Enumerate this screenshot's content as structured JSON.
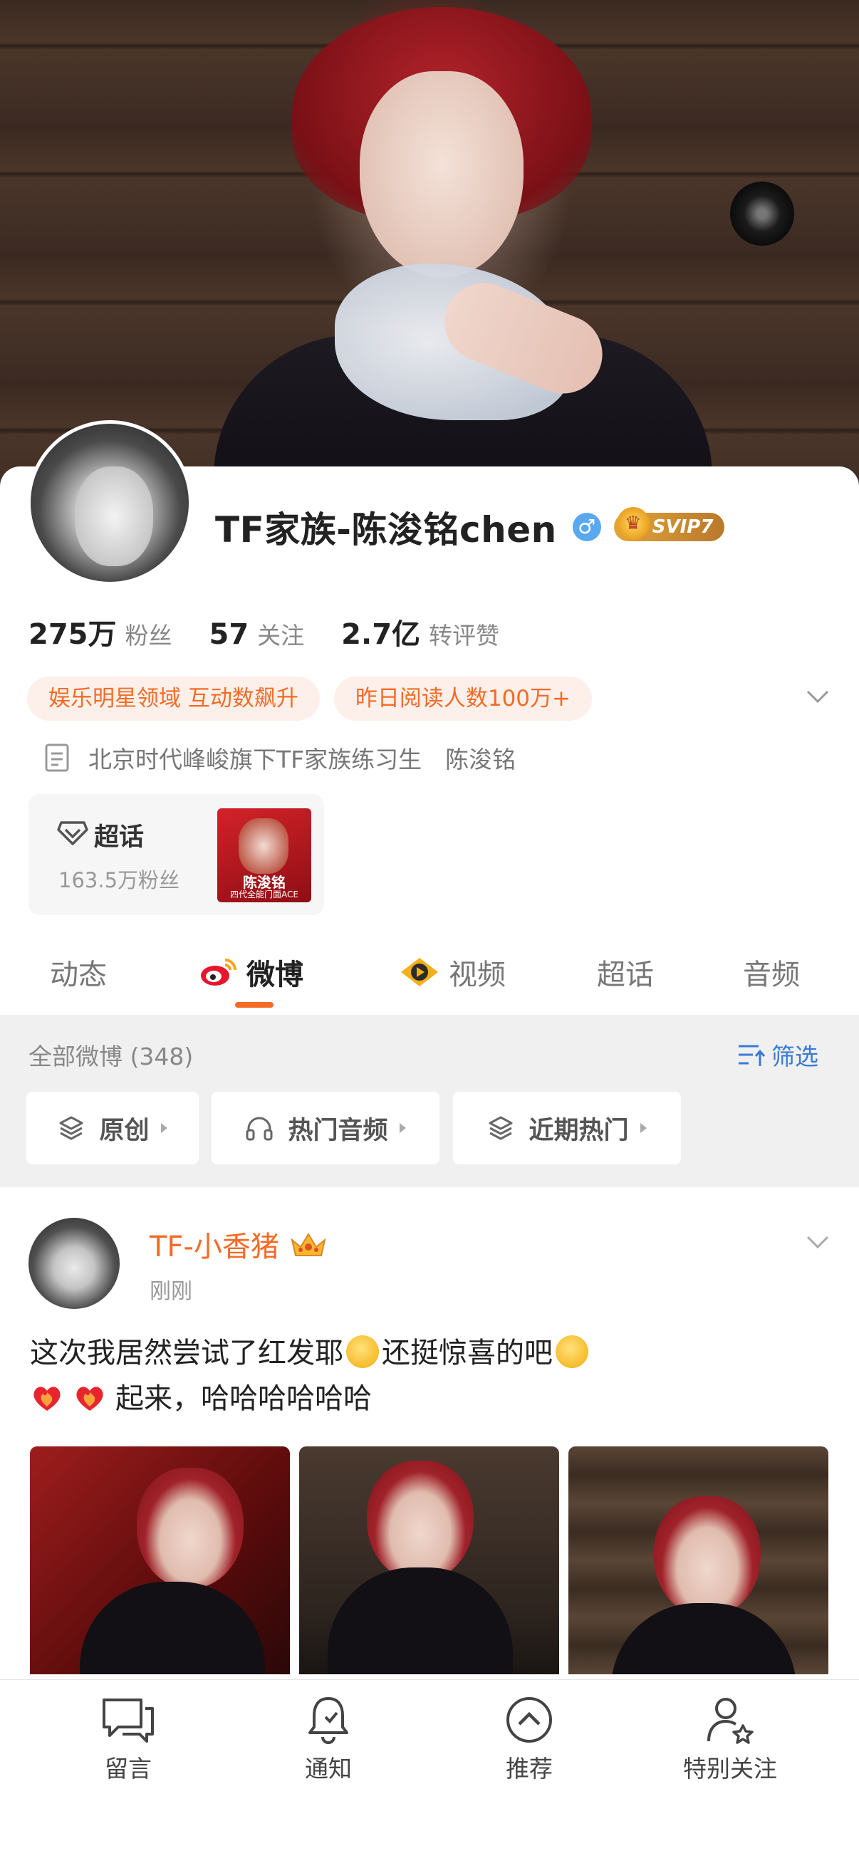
{
  "profile": {
    "name": "TF家族-陈浚铭chen",
    "gender_symbol": "♂",
    "vip_badge": "SVIP7"
  },
  "stats": [
    {
      "value": "275万",
      "label": "粉丝"
    },
    {
      "value": "57",
      "label": "关注"
    },
    {
      "value": "2.7亿",
      "label": "转评赞"
    }
  ],
  "tags": [
    "娱乐明星领域 互动数飙升",
    "昨日阅读人数100万+"
  ],
  "bio": "北京时代峰峻旗下TF家族练习生　陈浚铭",
  "super_topic": {
    "title": "超话",
    "fans": "163.5万粉丝",
    "cover_name": "陈浚铭",
    "cover_sub": "四代全能门面ACE"
  },
  "tabs": [
    "动态",
    "微博",
    "视频",
    "超话",
    "音频"
  ],
  "active_tab": "微博",
  "filter": {
    "count_label": "全部微博 (348)",
    "filter_button": "筛选",
    "chips": [
      "原创",
      "热门音频",
      "近期热门"
    ]
  },
  "post": {
    "author": "TF-小香猪",
    "time": "刚刚",
    "text_line1_a": "这次我居然尝试了红发耶",
    "text_line1_b": "还挺惊喜的吧",
    "text_line2": "起来，哈哈哈哈哈哈"
  },
  "bottom_nav": [
    {
      "label": "留言",
      "icon": "message-icon"
    },
    {
      "label": "通知",
      "icon": "bell-icon"
    },
    {
      "label": "推荐",
      "icon": "up-arrow-circle-icon"
    },
    {
      "label": "特别关注",
      "icon": "user-star-icon"
    }
  ],
  "colors": {
    "accent": "#f46b26",
    "link": "#3a7ad6",
    "tag_bg": "#fdf0ea"
  }
}
